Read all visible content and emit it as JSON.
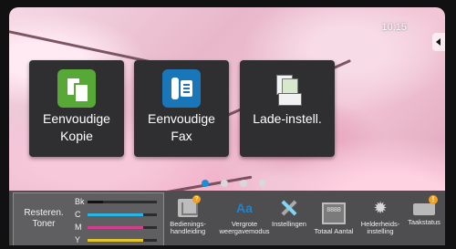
{
  "status": {
    "time": "10:15"
  },
  "tiles": [
    {
      "label_line1": "Eenvoudige",
      "label_line2": "Kopie",
      "icon": "copy-icon"
    },
    {
      "label_line1": "Eenvoudige",
      "label_line2": "Fax",
      "icon": "fax-icon"
    },
    {
      "label_line1": "Lade-instell.",
      "label_line2": "",
      "icon": "tray-settings-icon"
    }
  ],
  "toner": {
    "label_line1": "Resteren.",
    "label_line2": "Toner",
    "levels": [
      {
        "color_code": "Bk",
        "level": 0.22,
        "color": "#111111"
      },
      {
        "color_code": "C",
        "level": 0.8,
        "color": "#28b4e6"
      },
      {
        "color_code": "M",
        "level": 0.8,
        "color": "#d0408f"
      },
      {
        "color_code": "Y",
        "level": 0.8,
        "color": "#e0c52b"
      }
    ]
  },
  "bottom_buttons": [
    {
      "label_line1": "Bedienings-",
      "label_line2": "handleiding",
      "icon": "manual-icon"
    },
    {
      "label_line1": "Vergrote",
      "label_line2": "weergavemodus",
      "icon": "zoom-mode-icon"
    },
    {
      "label_line1": "Instellingen",
      "label_line2": "",
      "icon": "tools-icon"
    },
    {
      "label_line1": "Totaal Aantal",
      "label_line2": "",
      "icon": "counter-icon"
    },
    {
      "label_line1": "Helderheids-",
      "label_line2": "instelling",
      "icon": "brightness-icon"
    },
    {
      "label_line1": "Taakstatus",
      "label_line2": "",
      "icon": "job-status-icon"
    }
  ],
  "colors": {
    "active_page": "#1a8fd8",
    "panel": "#4e4e50",
    "tile": "#2f2f31"
  }
}
